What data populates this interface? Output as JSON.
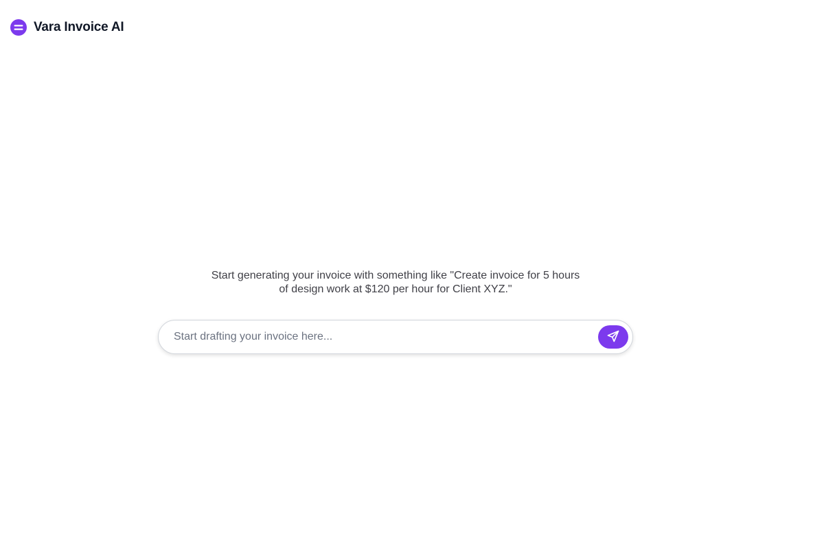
{
  "brand": {
    "name": "Vara Invoice AI",
    "logo_icon": "menu-circle-icon"
  },
  "main": {
    "hint_line1": "Start generating your invoice with something like \"Create invoice for 5 hours",
    "hint_line2": "of design work at $120 per hour for Client XYZ.\""
  },
  "composer": {
    "value": "",
    "placeholder": "Start drafting your invoice here...",
    "send_icon": "send-icon"
  },
  "colors": {
    "accent": "#7c3aed",
    "text_primary": "#111827",
    "text_muted": "#3f3f46"
  }
}
